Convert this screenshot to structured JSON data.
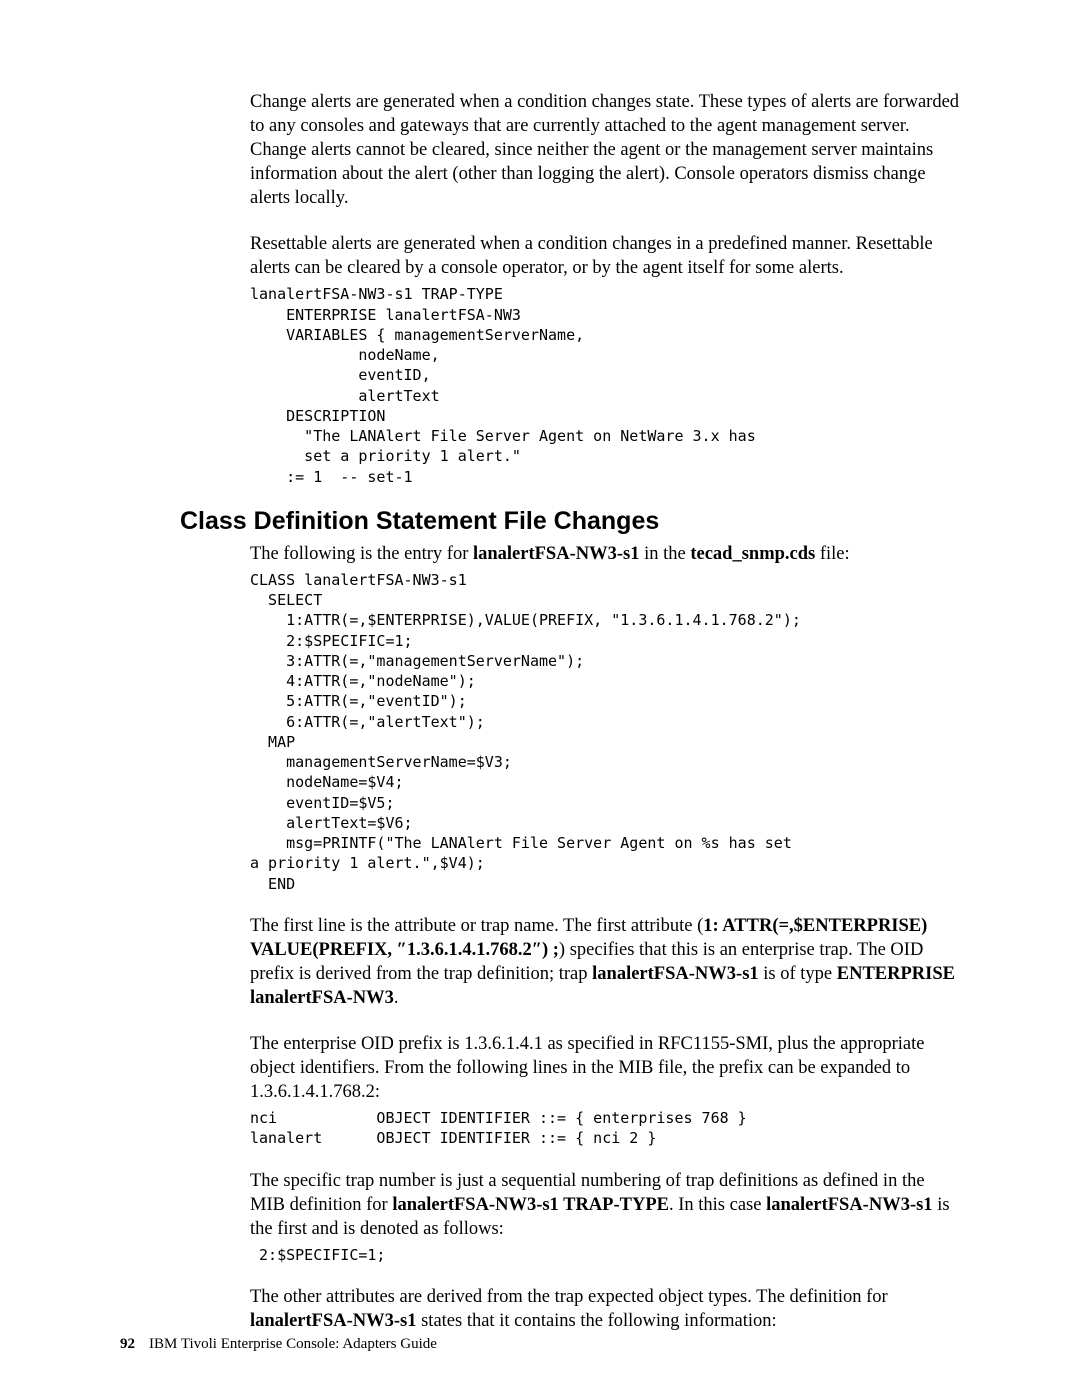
{
  "para1": "Change alerts are generated when a condition changes state. These types of alerts are forwarded to any consoles and gateways that are currently attached to the agent management server. Change alerts cannot be cleared, since neither the agent or the management server maintains information about the alert (other than logging the alert). Console operators dismiss change alerts locally.",
  "para2": "Resettable alerts are generated when a condition changes in a predefined manner. Resettable alerts can be cleared by a console operator, or by the agent itself for some alerts.",
  "code1": "lanalertFSA-NW3-s1 TRAP-TYPE\n    ENTERPRISE lanalertFSA-NW3\n    VARIABLES { managementServerName,\n            nodeName,\n            eventID,\n            alertText\n    DESCRIPTION\n      \"The LANAlert File Server Agent on NetWare 3.x has\n      set a priority 1 alert.\"\n    := 1  -- set-1",
  "heading1": "Class Definition Statement File Changes",
  "intro_pre": "The following is the entry for ",
  "intro_b1": "lanalertFSA-NW3-s1",
  "intro_mid": " in the ",
  "intro_b2": "tecad_snmp.cds",
  "intro_post": " file:",
  "code2": "CLASS lanalertFSA-NW3-s1\n  SELECT\n    1:ATTR(=,$ENTERPRISE),VALUE(PREFIX, \"1.3.6.1.4.1.768.2\");\n    2:$SPECIFIC=1;\n    3:ATTR(=,\"managementServerName\");\n    4:ATTR(=,\"nodeName\");\n    5:ATTR(=,\"eventID\");\n    6:ATTR(=,\"alertText\");\n  MAP\n    managementServerName=$V3;\n    nodeName=$V4;\n    eventID=$V5;\n    alertText=$V6;\n    msg=PRINTF(\"The LANAlert File Server Agent on %s has set\na priority 1 alert.\",$V4);\n  END",
  "p3a": "The first line is the attribute or trap name. The first attribute (",
  "p3b1": "1: ATTR(=,$ENTERPRISE) VALUE(PREFIX, ″1.3.6.1.4.1.768.2″) ;",
  "p3b": ") specifies that this is an enterprise trap. The OID prefix is derived from the trap definition; trap ",
  "p3b2": "lanalertFSA-NW3-s1",
  "p3c": " is of type ",
  "p3b3": "ENTERPRISE lanalertFSA-NW3",
  "p3d": ".",
  "para4": "The enterprise OID prefix is 1.3.6.1.4.1 as specified in RFC1155-SMI, plus the appropriate object identifiers. From the following lines in the MIB file, the prefix can be expanded to 1.3.6.1.4.1.768.2:",
  "code3": "nci           OBJECT IDENTIFIER ::= { enterprises 768 }\nlanalert      OBJECT IDENTIFIER ::= { nci 2 }",
  "p5a": "The specific trap number is just a sequential numbering of trap definitions as defined in the MIB definition for ",
  "p5b1": "lanalertFSA-NW3-s1 TRAP-TYPE",
  "p5b": ". In this case ",
  "p5b2": "lanalertFSA-NW3-s1",
  "p5c": " is the first and is denoted as follows:",
  "code4": " 2:$SPECIFIC=1;",
  "p6a": "The other attributes are derived from the trap expected object types. The definition for ",
  "p6b1": "lanalertFSA-NW3-s1",
  "p6b": " states that it contains the following information:",
  "footer_page": "92",
  "footer_text": "IBM Tivoli Enterprise Console: Adapters Guide"
}
